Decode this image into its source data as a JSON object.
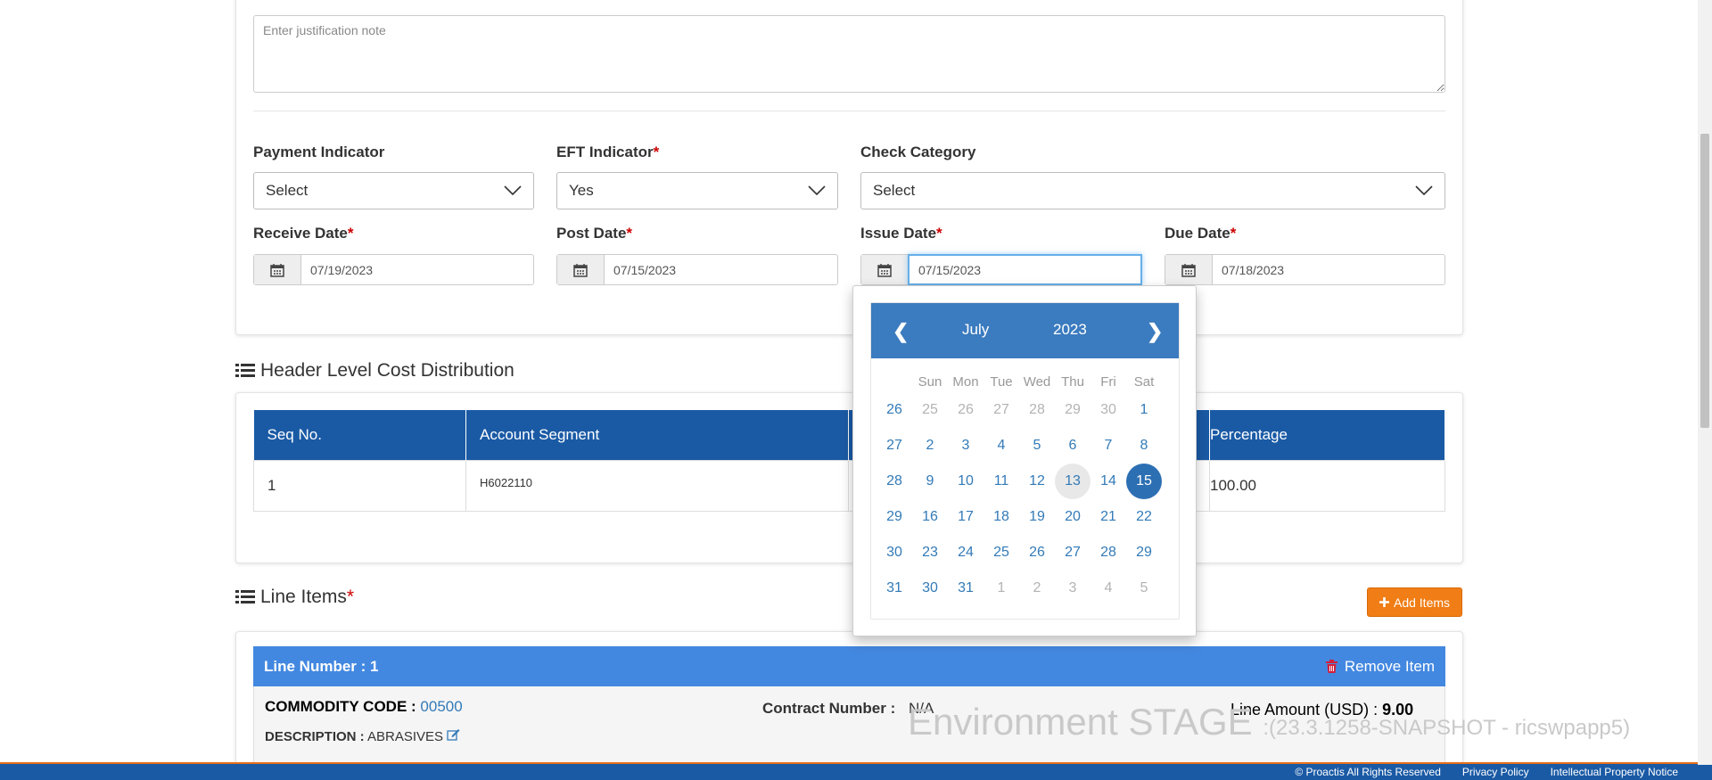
{
  "justification": {
    "placeholder": "Enter justification note"
  },
  "fields": {
    "payment_indicator": {
      "label": "Payment Indicator",
      "value": "Select"
    },
    "eft_indicator": {
      "label": "EFT Indicator",
      "value": "Yes",
      "required": "*"
    },
    "check_category": {
      "label": "Check Category",
      "value": "Select"
    },
    "receive_date": {
      "label": "Receive Date",
      "value": "07/19/2023",
      "required": "*"
    },
    "post_date": {
      "label": "Post Date",
      "value": "07/15/2023",
      "required": "*"
    },
    "issue_date": {
      "label": "Issue Date",
      "value": "07/15/2023",
      "required": "*"
    },
    "due_date": {
      "label": "Due Date",
      "value": "07/18/2023",
      "required": "*"
    }
  },
  "cost_distribution": {
    "title": "Header Level Cost Distribution",
    "columns": [
      "Seq No.",
      "Account Segment",
      "",
      "Percentage"
    ],
    "rows": [
      {
        "seq": "1",
        "account": "H6022110",
        "mid": "",
        "percentage": "100.00"
      }
    ]
  },
  "line_items": {
    "title": "Line Items",
    "required": "*",
    "add_label": "Add Items",
    "line_number_label": "Line Number : 1",
    "remove_label": "Remove Item",
    "commodity_label": "COMMODITY CODE :",
    "commodity_value": "00500",
    "description_label": "DESCRIPTION :",
    "description_value": "ABRASIVES",
    "contract_label": "Contract Number :",
    "contract_value": "N/A",
    "amount_label": "Line Amount (USD) :",
    "amount_value": "9.00"
  },
  "datepicker": {
    "prev": "❮",
    "next": "❯",
    "month": "July",
    "year": "2023",
    "weekdays": [
      "Sun",
      "Mon",
      "Tue",
      "Wed",
      "Thu",
      "Fri",
      "Sat"
    ],
    "weeks": [
      [
        "26",
        "25",
        "26",
        "27",
        "28",
        "29",
        "30",
        "1"
      ],
      [
        "27",
        "2",
        "3",
        "4",
        "5",
        "6",
        "7",
        "8"
      ],
      [
        "28",
        "9",
        "10",
        "11",
        "12",
        "13",
        "14",
        "15"
      ],
      [
        "29",
        "16",
        "17",
        "18",
        "19",
        "20",
        "21",
        "22"
      ],
      [
        "30",
        "23",
        "24",
        "25",
        "26",
        "27",
        "28",
        "29"
      ],
      [
        "31",
        "30",
        "31",
        "1",
        "2",
        "3",
        "4",
        "5"
      ]
    ],
    "today": "13",
    "selected": "15"
  },
  "watermark": {
    "env": "Environment  STAGE",
    "build": ":(23.3.1258-SNAPSHOT - ricswpapp5)"
  },
  "footer": {
    "copyright": "© Proactis All Rights Reserved",
    "privacy": "Privacy Policy",
    "ip": "Intellectual Property Notice"
  },
  "colors": {
    "primary": "#1a5aa5",
    "accent": "#f07d15",
    "required": "#cc0000",
    "line_header": "#4388e0"
  }
}
